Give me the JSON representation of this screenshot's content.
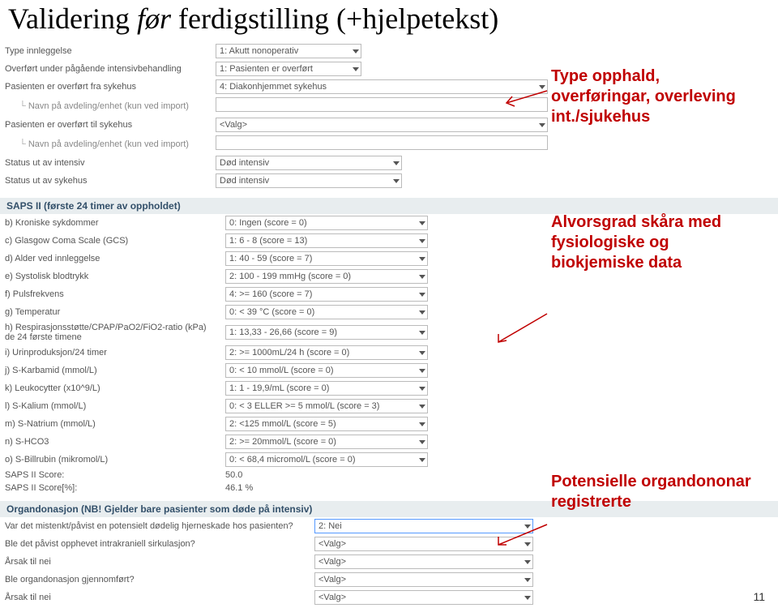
{
  "title": {
    "prefix": "Validering ",
    "ital": "før",
    "suffix": " ferdigstilling (+hjelpetekst)"
  },
  "top": {
    "rows": [
      {
        "label": "Type innleggelse",
        "value": "1: Akutt nonoperativ",
        "ddclass": "small"
      },
      {
        "label": "Overført under pågående intensivbehandling",
        "value": "1: Pasienten er overført",
        "ddclass": "small"
      },
      {
        "label": "Pasienten er overført fra sykehus",
        "value": "4: Diakonhjemmet sykehus",
        "ddclass": "full"
      },
      {
        "label": "Navn på avdeling/enhet (kun ved import)",
        "value": "",
        "sub": true,
        "txt": true,
        "grey": true
      },
      {
        "label": "Pasienten er overført til sykehus",
        "value": "<Valg>",
        "ddclass": "full"
      },
      {
        "label": "Navn på avdeling/enhet (kun ved import)",
        "value": "",
        "sub": true,
        "txt": true,
        "grey": true
      },
      {
        "label": "Status ut av intensiv",
        "value": "Død intensiv",
        "ddclass": "med",
        "grey": true
      },
      {
        "label": "Status ut av sykehus",
        "value": "Død intensiv",
        "ddclass": "med",
        "grey": true
      }
    ]
  },
  "saps": {
    "header": "SAPS II (første 24 timer av oppholdet)",
    "rows": [
      {
        "label": "b) Kroniske sykdommer",
        "value": "0: Ingen (score = 0)"
      },
      {
        "label": "c) Glasgow Coma Scale (GCS)",
        "value": "1: 6 - 8 (score = 13)"
      },
      {
        "label": "d) Alder ved innleggelse",
        "value": "1: 40 - 59 (score = 7)",
        "grey": true
      },
      {
        "label": "e) Systolisk blodtrykk",
        "value": "2: 100 - 199 mmHg (score = 0)"
      },
      {
        "label": "f) Pulsfrekvens",
        "value": "4: >= 160 (score = 7)"
      },
      {
        "label": "g) Temperatur",
        "value": "0: < 39 °C (score = 0)"
      },
      {
        "label": "h) Respirasjonsstøtte/CPAP/PaO2/FiO2-ratio (kPa) de 24 første timene",
        "value": "1: 13,33 - 26,66 (score = 9)"
      },
      {
        "label": "i) Urinproduksjon/24 timer",
        "value": "2: >= 1000mL/24 h (score = 0)"
      },
      {
        "label": "j) S-Karbamid (mmol/L)",
        "value": "0: < 10 mmol/L (score = 0)"
      },
      {
        "label": "k) Leukocytter (x10^9/L)",
        "value": "1: 1 - 19,9/mL (score = 0)"
      },
      {
        "label": "l) S-Kalium (mmol/L)",
        "value": "0: < 3 ELLER >= 5 mmol/L (score = 3)"
      },
      {
        "label": "m) S-Natrium (mmol/L)",
        "value": "2: <125 mmol/L (score = 5)"
      },
      {
        "label": "n) S-HCO3",
        "value": "2: >= 20mmol/L (score = 0)"
      },
      {
        "label": "o) S-Billrubin (mikromol/L)",
        "value": "0: < 68,4 micromol/L (score = 0)"
      },
      {
        "label": "SAPS II Score:",
        "value": "50.0",
        "plain": true
      },
      {
        "label": "SAPS II Score[%]:",
        "value": "46.1 %",
        "plain": true
      }
    ]
  },
  "organ": {
    "header": "Organdonasjon (NB! Gjelder bare pasienter som døde på intensiv)",
    "rows": [
      {
        "label": "Var det mistenkt/påvist en potensielt dødelig hjerneskade hos pasienten?",
        "value": "2: Nei",
        "editable": true
      },
      {
        "label": "Ble det påvist opphevet intrakraniell sirkulasjon?",
        "value": "<Valg>",
        "grey": true
      },
      {
        "label": "Årsak til nei",
        "value": "<Valg>",
        "grey": true
      },
      {
        "label": "Ble organdonasjon gjennomført?",
        "value": "<Valg>",
        "grey": true
      },
      {
        "label": "Årsak til nei",
        "value": "<Valg>",
        "grey": true
      }
    ]
  },
  "callouts": {
    "c1": "Type opphald, overføringar, overleving int./sjukehus",
    "c2": "Alvorsgrad skåra med fysiologiske og biokjemiske data",
    "c3": "Potensielle organdononar registrerte"
  },
  "pagenum": "11"
}
